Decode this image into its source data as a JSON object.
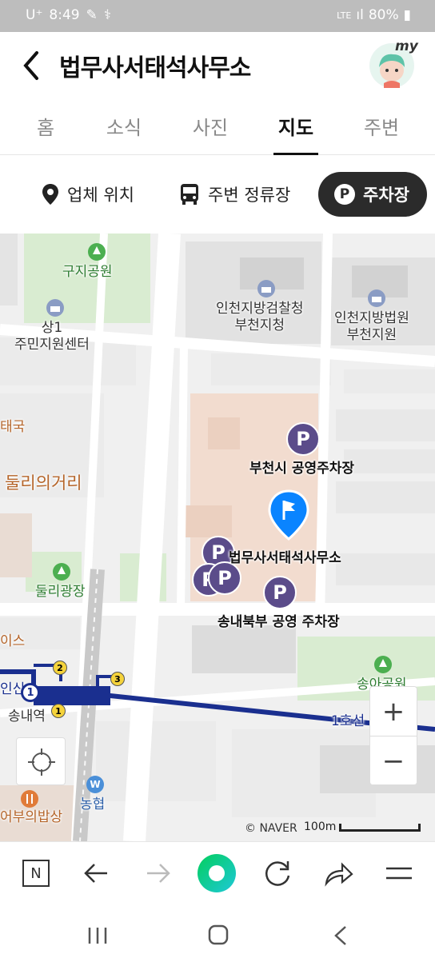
{
  "status_bar": {
    "carrier": "U⁺",
    "time": "8:49",
    "network": "LTE",
    "battery": "80%"
  },
  "header": {
    "title": "법무사서태석사무소",
    "avatar_badge": "my"
  },
  "tabs": [
    {
      "label": "홈"
    },
    {
      "label": "소식"
    },
    {
      "label": "사진"
    },
    {
      "label": "지도",
      "active": true
    },
    {
      "label": "주변"
    }
  ],
  "chips": [
    {
      "label": "업체 위치",
      "icon": "location-pin-icon"
    },
    {
      "label": "주변 정류장",
      "icon": "bus-icon"
    },
    {
      "label": "주차장",
      "icon": "parking-icon",
      "active": true
    }
  ],
  "map": {
    "labels": {
      "park1": "구지공원",
      "prosecutor": "인천지방검찰청\n부천지청",
      "court": "인천지방법원\n부천지원",
      "center": "상1\n주민지원센터",
      "country": "태국",
      "street": "둘리의거리",
      "square": "둘리광장",
      "ice": "이스",
      "station": "송내역",
      "line": "1호선",
      "park2": "송아공원",
      "bank": "농협",
      "restaurant": "어부의밥상",
      "station_partial": "인신"
    },
    "parking": {
      "lot1": "부천시 공영주차장",
      "lot2": "송내북부 공영 주차장",
      "marker_symbol": "P"
    },
    "place": "법무사서태석사무소",
    "exits": [
      "2",
      "3",
      "1"
    ],
    "line_number": "1",
    "bank_symbol": "W",
    "zoom_in": "+",
    "zoom_out": "−",
    "copyright": "© NAVER",
    "scale": "100m"
  },
  "browser_bar": {
    "home": "N"
  },
  "colors": {
    "parking": "#5b4c8a",
    "pin": "#0a84ff",
    "subway": "#1a2f8f",
    "park": "#cfe8c4",
    "building": "#f2dccf"
  }
}
